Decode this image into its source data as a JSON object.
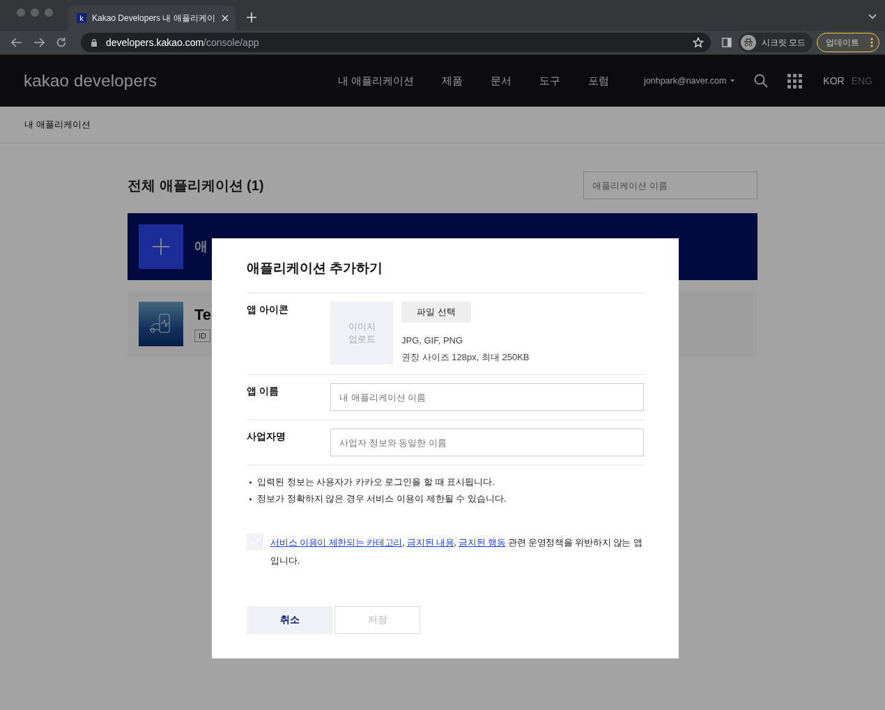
{
  "browser": {
    "tab": {
      "title": "Kakao Developers 내 애플리케이",
      "favicon": "k"
    },
    "address": {
      "host": "developers.kakao.com",
      "path": "/console/app"
    },
    "incognito": "시크릿 모드",
    "update": "업데이트"
  },
  "header": {
    "logo": "kakao developers",
    "nav": [
      "내 애플리케이션",
      "제품",
      "문서",
      "도구",
      "포럼"
    ],
    "account": "jonhpark@naver.com",
    "languages": [
      {
        "label": "KOR",
        "selected": true
      },
      {
        "label": "ENG",
        "selected": false
      }
    ]
  },
  "breadcrumb": "내 애플리케이션",
  "content": {
    "title": "전체 애플리케이션 (1)",
    "search": {
      "placeholder": "애플리케이션 이름"
    },
    "add_card": {
      "label": "애"
    },
    "apps": [
      {
        "name": "Te",
        "badge": "ID"
      }
    ]
  },
  "modal": {
    "title": "애플리케이션 추가하기",
    "icon_row": {
      "label": "앱 아이콘",
      "upload": "이미지 업로드",
      "button": "파일 선택",
      "hints": [
        "JPG, GIF, PNG",
        "권장 사이즈 128px, 최대 250KB"
      ]
    },
    "fields": [
      {
        "label": "앱 이름",
        "placeholder": "내 애플리케이션 이름"
      },
      {
        "label": "사업자명",
        "placeholder": "사업자 정보와 동일한 이름"
      }
    ],
    "notes": [
      "입력된 정보는 사용자가 카카오 로그인을 할 때 표시됩니다.",
      "정보가 정확하지 않은 경우 서비스 이용이 제한될 수 있습니다."
    ],
    "agreement": {
      "checked": false,
      "parts": [
        {
          "kind": "link",
          "text": "서비스 이용이 제한되는 카테고리"
        },
        {
          "kind": "text",
          "text": ", "
        },
        {
          "kind": "link",
          "text": "금지된 내용"
        },
        {
          "kind": "text",
          "text": ", "
        },
        {
          "kind": "link",
          "text": "금지된 행동"
        },
        {
          "kind": "text",
          "text": " 관련 운영정책을 위반하지 않는 앱입니다."
        }
      ]
    },
    "buttons": [
      {
        "label": "취소",
        "disabled": false
      },
      {
        "label": "저장",
        "disabled": true
      }
    ]
  }
}
